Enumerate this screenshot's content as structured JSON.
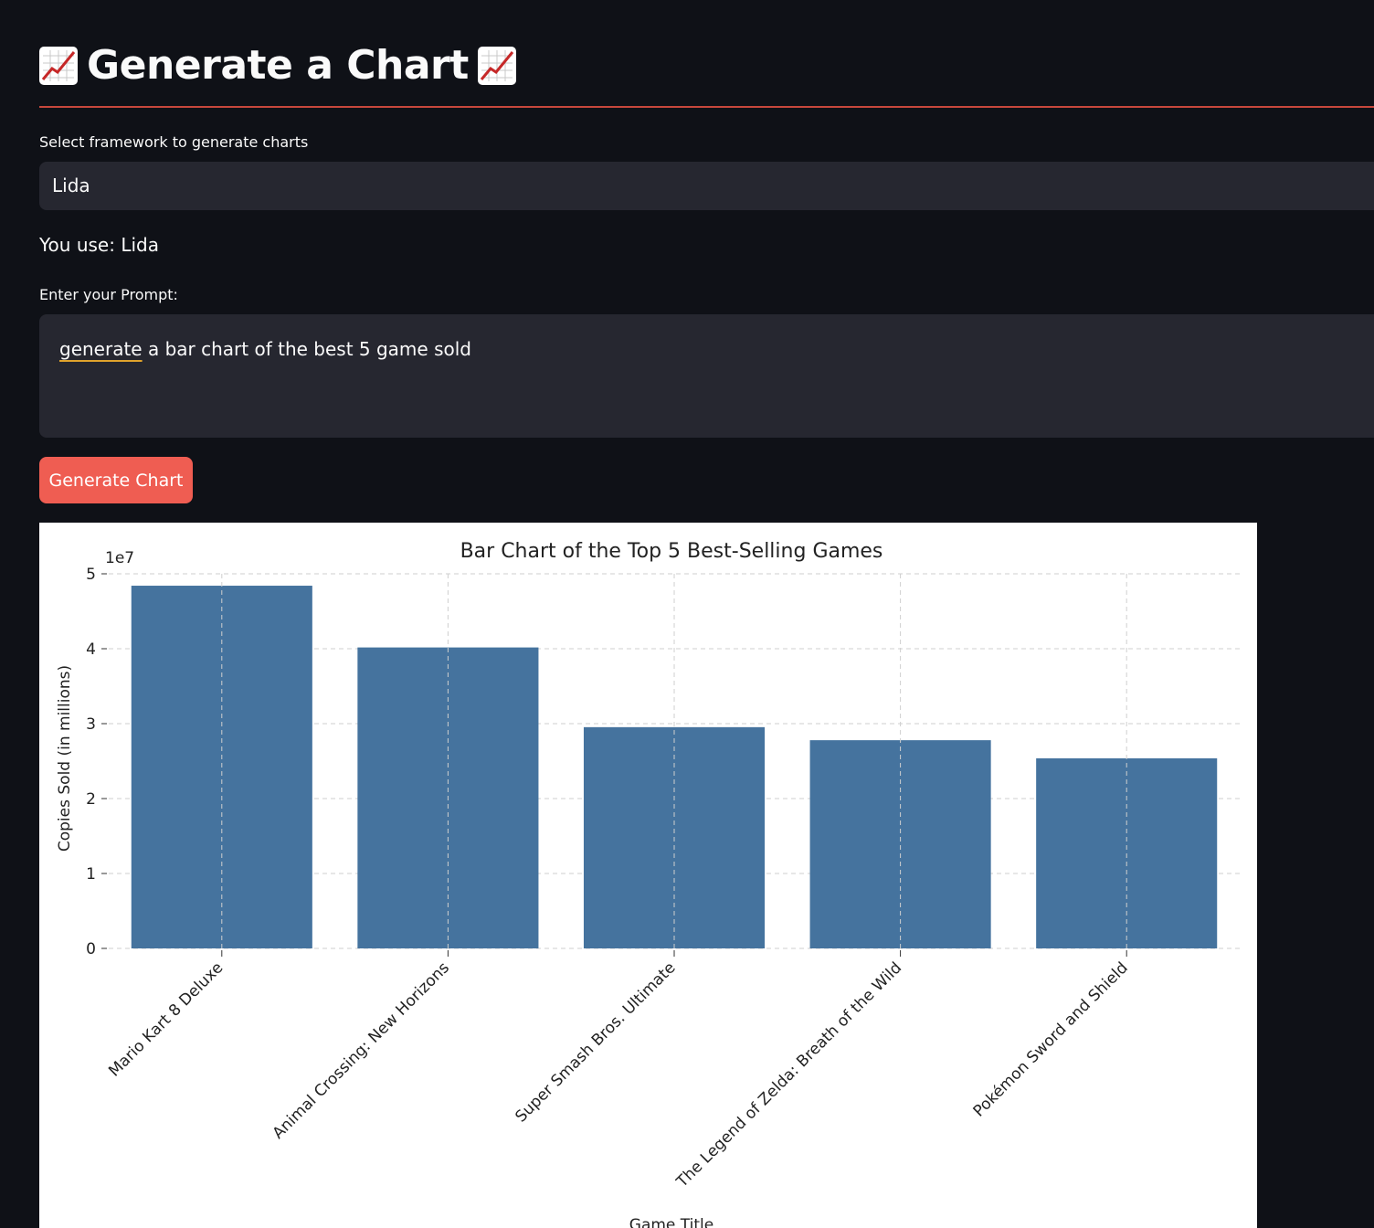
{
  "header": {
    "title": "Generate a Chart",
    "icon": "chart-increasing-icon"
  },
  "framework": {
    "label": "Select framework to generate charts",
    "selected": "Lida",
    "you_use": "You use: Lida"
  },
  "prompt": {
    "label": "Enter your Prompt:",
    "first_word": "generate",
    "rest": " a bar chart of the best 5 game sold"
  },
  "generate_button": {
    "label": "Generate Chart"
  },
  "colors": {
    "background": "#0f1117",
    "input_bg": "#262730",
    "accent": "#ef5d52",
    "bar": "#45739e"
  },
  "chart_data": {
    "type": "bar",
    "title": "Bar Chart of the Top 5 Best-Selling Games",
    "xlabel": "Game Title",
    "ylabel": "Copies Sold (in millions)",
    "y_offset_label": "1e7",
    "categories": [
      "Mario Kart 8 Deluxe",
      "Animal Crossing: New Horizons",
      "Super Smash Bros. Ultimate",
      "The Legend of Zelda: Breath of the Wild",
      "Pokémon Sword and Shield"
    ],
    "values": [
      48410000,
      40170000,
      29530000,
      27790000,
      25370000
    ],
    "ylim": [
      0,
      50000000
    ],
    "yticks": [
      0,
      10000000,
      20000000,
      30000000,
      40000000,
      50000000
    ],
    "ytick_labels": [
      "0",
      "1",
      "2",
      "3",
      "4",
      "5"
    ],
    "grid": true,
    "bar_color": "#45739e"
  }
}
